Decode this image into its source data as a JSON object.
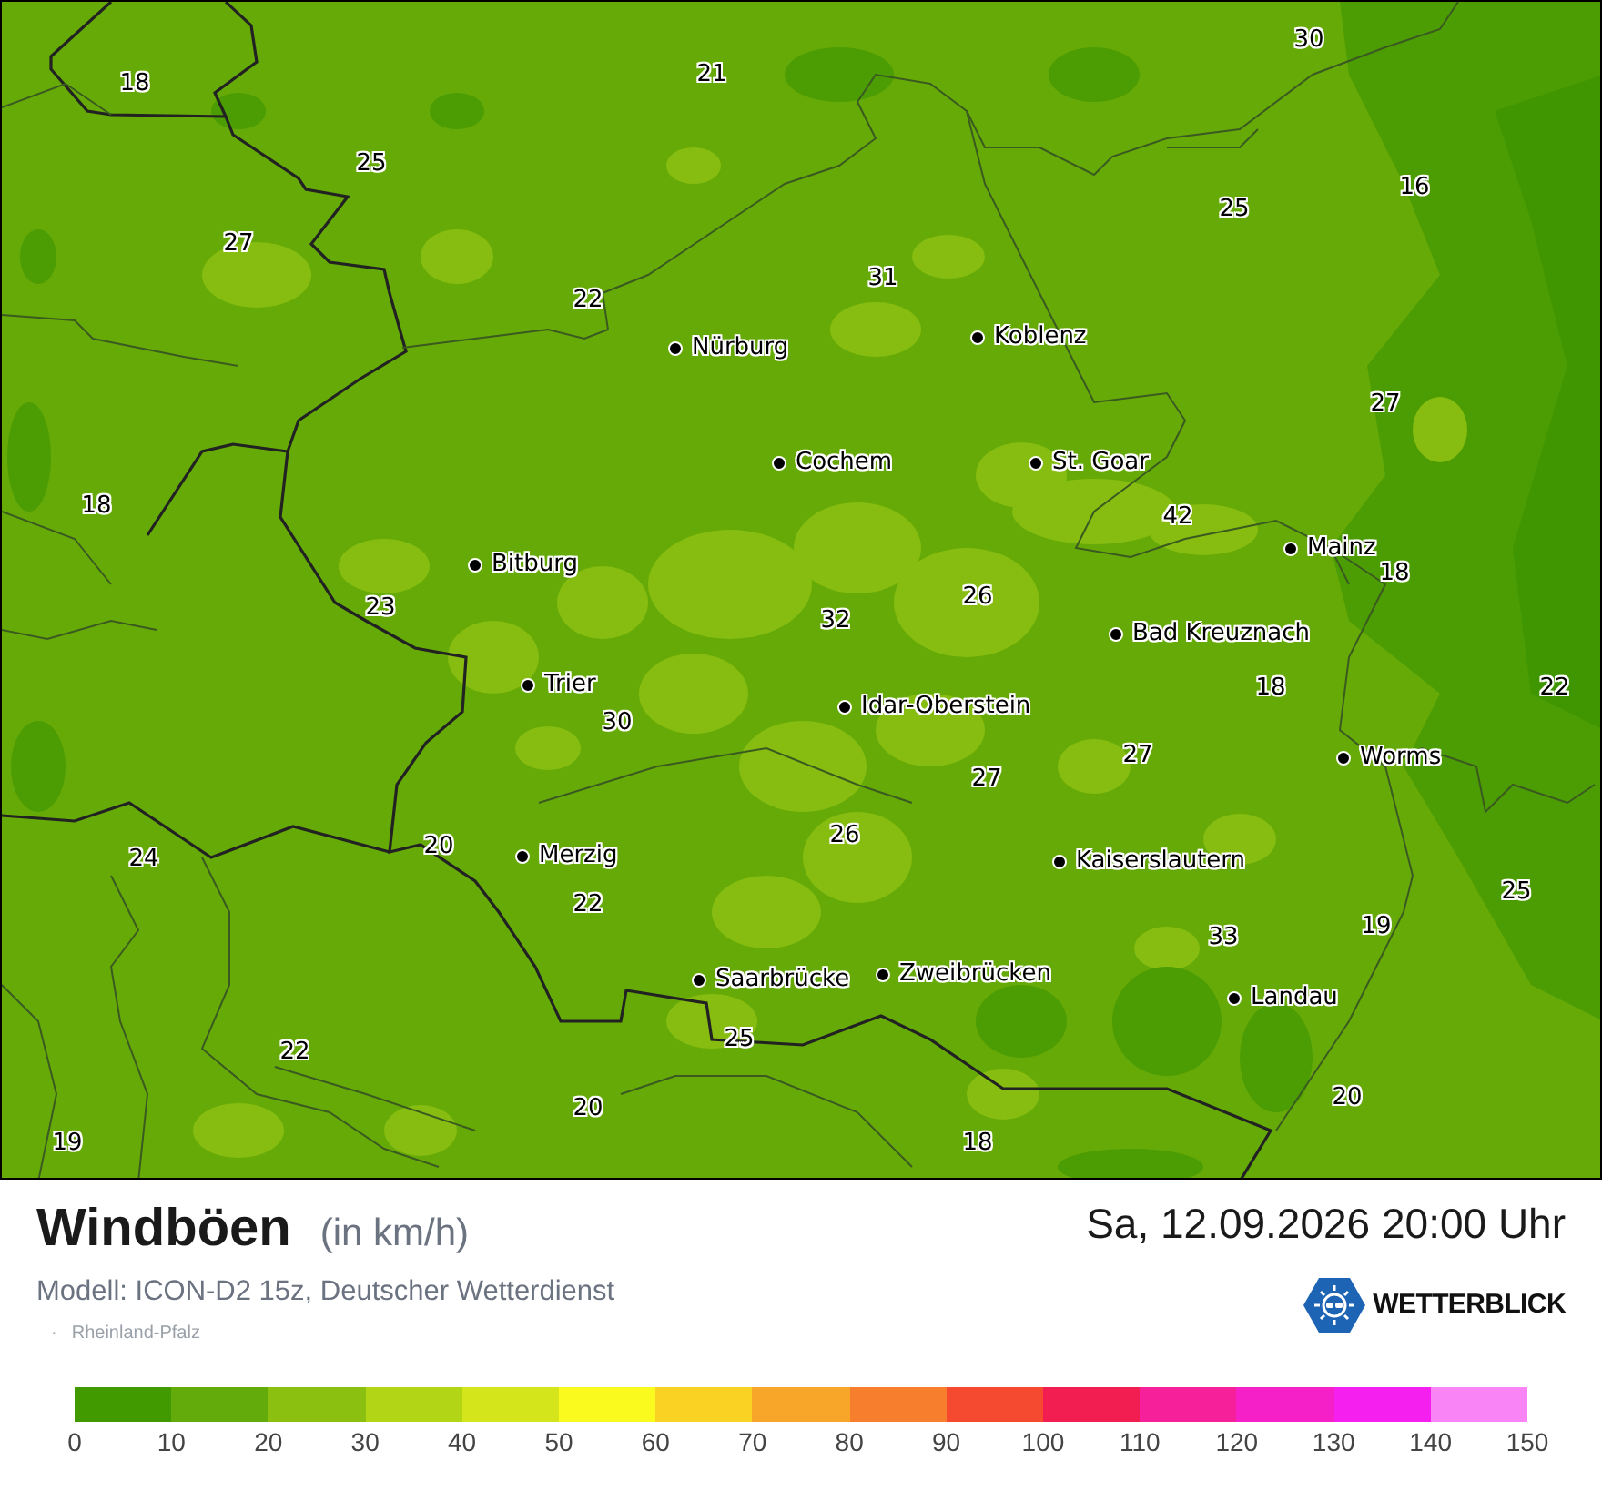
{
  "map": {
    "wind_values": [
      "18",
      "21",
      "30",
      "25",
      "25",
      "16",
      "27",
      "31",
      "22",
      "27",
      "18",
      "42",
      "18",
      "23",
      "26",
      "32",
      "22",
      "18",
      "30",
      "27",
      "27",
      "24",
      "20",
      "26",
      "22",
      "25",
      "19",
      "33",
      "25",
      "22",
      "20",
      "20",
      "19",
      "18"
    ],
    "cities": [
      "Nürburg",
      "Koblenz",
      "Cochem",
      "St. Goar",
      "Bitburg",
      "Mainz",
      "Bad Kreuznach",
      "Trier",
      "Idar-Oberstein",
      "Worms",
      "Merzig",
      "Kaiserslautern",
      "Saarbrücke",
      "Zweibrücken",
      "Landau"
    ]
  },
  "header": {
    "title": "Windböen",
    "unit": "(in km/h)",
    "model": "Modell: ICON-D2 15z, Deutscher Wetterdienst",
    "region_bullet": "·",
    "region": "Rheinland-Pfalz"
  },
  "timestamp": "Sa, 12.09.2026 20:00 Uhr",
  "logo": {
    "text": "WETTERBLICK"
  },
  "legend": {
    "segments": [
      {
        "color": "#419a00"
      },
      {
        "color": "#63ab0a"
      },
      {
        "color": "#8cc010"
      },
      {
        "color": "#b2d515"
      },
      {
        "color": "#d4e51c"
      },
      {
        "color": "#fafa1e"
      },
      {
        "color": "#f9d223"
      },
      {
        "color": "#f8a62a"
      },
      {
        "color": "#f67e2d"
      },
      {
        "color": "#f54a2f"
      },
      {
        "color": "#f21e52"
      },
      {
        "color": "#f5209a"
      },
      {
        "color": "#f520c8"
      },
      {
        "color": "#f520f0"
      },
      {
        "color": "#f884f5"
      }
    ],
    "ticks": [
      "0",
      "10",
      "20",
      "30",
      "40",
      "50",
      "60",
      "70",
      "80",
      "90",
      "100",
      "110",
      "120",
      "130",
      "140",
      "150"
    ]
  }
}
